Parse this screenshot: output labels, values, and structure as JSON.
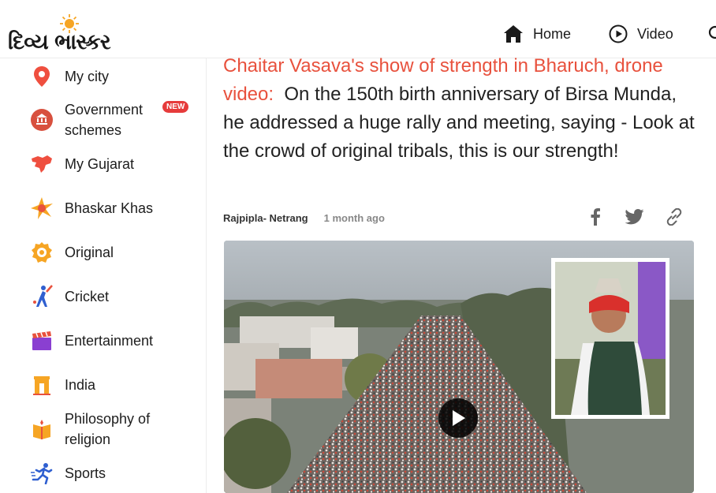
{
  "header": {
    "logo_text": "દિવ્ય ભાસ્કર",
    "nav": [
      {
        "label": "Home",
        "icon": "home-icon"
      },
      {
        "label": "Video",
        "icon": "play-circle-icon"
      }
    ],
    "search_icon": "search-icon"
  },
  "sidebar": {
    "items": [
      {
        "label": "My city",
        "icon": "location-pin-icon",
        "color": "#e8513d"
      },
      {
        "label": "Government schemes",
        "line1": "Government",
        "line2": "schemes",
        "icon": "government-building-icon",
        "badge": "NEW"
      },
      {
        "label": "My Gujarat",
        "icon": "gujarat-map-icon"
      },
      {
        "label": "Bhaskar Khas",
        "icon": "star-burst-icon"
      },
      {
        "label": "Original",
        "icon": "original-badge-icon"
      },
      {
        "label": "Cricket",
        "icon": "cricket-player-icon"
      },
      {
        "label": "Entertainment",
        "icon": "clapperboard-icon"
      },
      {
        "label": "India",
        "icon": "india-gate-icon"
      },
      {
        "label": "Philosophy of religion",
        "line1": "Philosophy of",
        "line2": "religion",
        "icon": "book-icon"
      },
      {
        "label": "Sports",
        "icon": "runner-icon"
      }
    ]
  },
  "article": {
    "kicker": "Chaitar Vasava's show of strength in Bharuch, drone video:",
    "headline": "On the 150th birth anniversary of Birsa Munda, he addressed a huge rally and meeting, saying - Look at the crowd of original tribals, this is our strength!",
    "location": "Rajpipla- Netrang",
    "time": "1 month ago",
    "share_icons": [
      "facebook-icon",
      "twitter-icon",
      "link-icon"
    ],
    "accent_color": "#e8513d"
  },
  "video": {
    "play_icon": "play-icon",
    "description": "drone view of rally crowd with inset speaker"
  }
}
